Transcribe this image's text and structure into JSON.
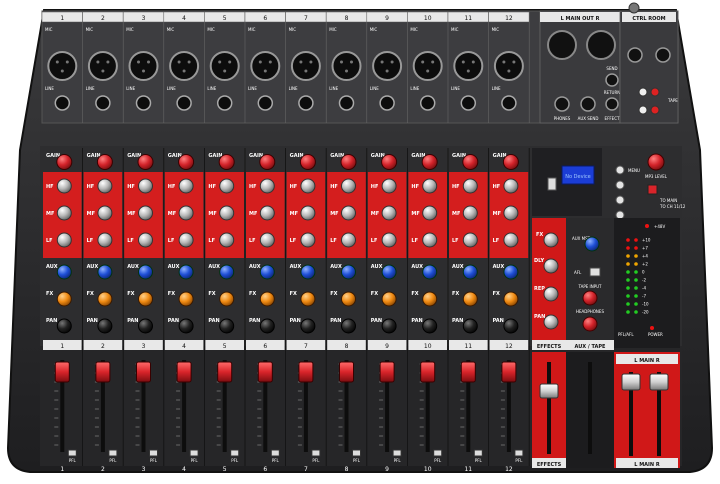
{
  "channels": [
    "1",
    "2",
    "3",
    "4",
    "5",
    "6",
    "7",
    "8",
    "9",
    "10",
    "11",
    "12"
  ],
  "input_labels": {
    "mic": "MIC",
    "line": "LINE"
  },
  "channel_labels": {
    "gain": "GAIN",
    "hf": "HF",
    "mf": "MF",
    "lf": "LF",
    "aux": "AUX",
    "fx": "FX",
    "pan": "PAN",
    "pfl": "PFL"
  },
  "main_out": {
    "label": "L  MAIN OUT  R"
  },
  "ctrl_room": {
    "label": "CTRL ROOM"
  },
  "rear_io": {
    "phones": "PHONES",
    "aux_send": "AUX SEND",
    "send": "SEND",
    "return": "RETURN",
    "effect": "EFFECT",
    "tape": "TAPE"
  },
  "mp3": {
    "display": "No Device",
    "menu": "MENU",
    "mp3_level": "MP3 LEVEL",
    "to_main": "TO MAIN",
    "to_ch": "TO CH 11/12"
  },
  "effects_strip": {
    "fx": "FX",
    "dly": "DLY",
    "rep": "REP",
    "pan": "PAN",
    "label": "EFFECTS"
  },
  "aux_tape": {
    "aux_mst": "AUX MST",
    "afl": "AFL",
    "tape_input": "TAPE INPUT",
    "headphones": "HEADPHONES",
    "label": "AUX / TAPE"
  },
  "meter": {
    "phantom": "+48V",
    "levels": [
      "+10",
      "+7",
      "+4",
      "+2",
      "0",
      "-2",
      "-4",
      "-7",
      "-10",
      "-20"
    ],
    "pfl_afl": "PFL/AFL",
    "power": "POWER"
  },
  "master": {
    "label": "L  MAIN  R"
  },
  "bottom_labels": {
    "effects": "EFFECTS",
    "main": "L  MAIN  R"
  },
  "colors": {
    "panel": "#2b2b2d",
    "eq_band": "#d41e1e",
    "gain_knob": "#d3232a",
    "aux_knob": "#1e4fd6",
    "fx_knob": "#f08a12",
    "fader_cap": "#d8242a",
    "effects_red": "#d01818"
  }
}
